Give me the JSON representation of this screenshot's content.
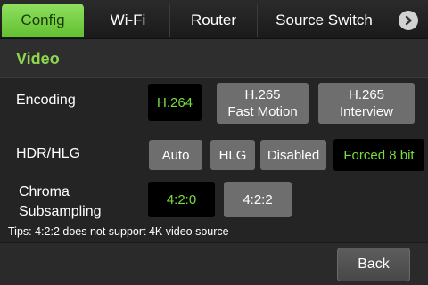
{
  "tabs": [
    {
      "label": "Config",
      "active": true
    },
    {
      "label": "Wi-Fi",
      "active": false
    },
    {
      "label": "Router",
      "active": false
    },
    {
      "label": "Source Switch",
      "active": false
    }
  ],
  "tab_scroll_icon": "chevron-right-icon",
  "section": {
    "title": "Video"
  },
  "encoding": {
    "label": "Encoding",
    "options": [
      {
        "label": "H.264",
        "selected": true
      },
      {
        "label": "H.265\nFast Motion",
        "selected": false
      },
      {
        "label": "H.265\nInterview",
        "selected": false
      }
    ]
  },
  "hdr": {
    "label": "HDR/HLG",
    "options": [
      {
        "label": "Auto",
        "selected": false
      },
      {
        "label": "HLG",
        "selected": false
      },
      {
        "label": "Disabled",
        "selected": false
      },
      {
        "label": "Forced 8 bit",
        "selected": true
      }
    ]
  },
  "chroma": {
    "label": "Chroma\nSubsampling",
    "options": [
      {
        "label": "4:2:0",
        "selected": true
      },
      {
        "label": "4:2:2",
        "selected": false
      }
    ]
  },
  "tips": "Tips: 4:2:2 does not support 4K video source",
  "footer": {
    "back_label": "Back"
  },
  "colors": {
    "accent": "#78dc3c",
    "active_tab": "#7ad048",
    "button": "#6e6e6e",
    "selected": "#000000"
  }
}
